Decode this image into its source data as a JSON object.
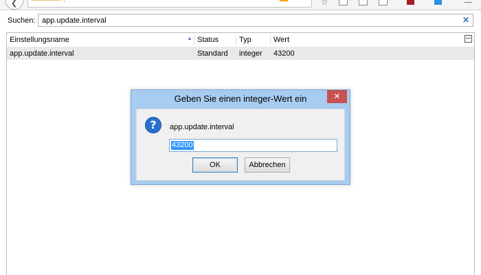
{
  "search": {
    "label": "Suchen:",
    "value": "app.update.interval"
  },
  "table": {
    "columns": [
      "Einstellungsname",
      "Status",
      "Typ",
      "Wert"
    ],
    "rows": [
      {
        "name": "app.update.interval",
        "status": "Standard",
        "type": "integer",
        "value": "43200"
      }
    ]
  },
  "dialog": {
    "title": "Geben Sie einen integer-Wert ein",
    "close_glyph": "✕",
    "message": "app.update.interval",
    "input_value": "43200",
    "ok_label": "OK",
    "cancel_label": "Abbrechen"
  },
  "icons": {
    "back": "back-arrow-icon",
    "bookmark": "star-icon",
    "question": "question-icon",
    "clear": "close-icon",
    "column_picker": "column-picker-icon"
  },
  "colors": {
    "dialog_frame": "#a7ccef",
    "close_button": "#c75050",
    "selection": "#3399ff",
    "row_highlight": "#e9e9e9"
  }
}
